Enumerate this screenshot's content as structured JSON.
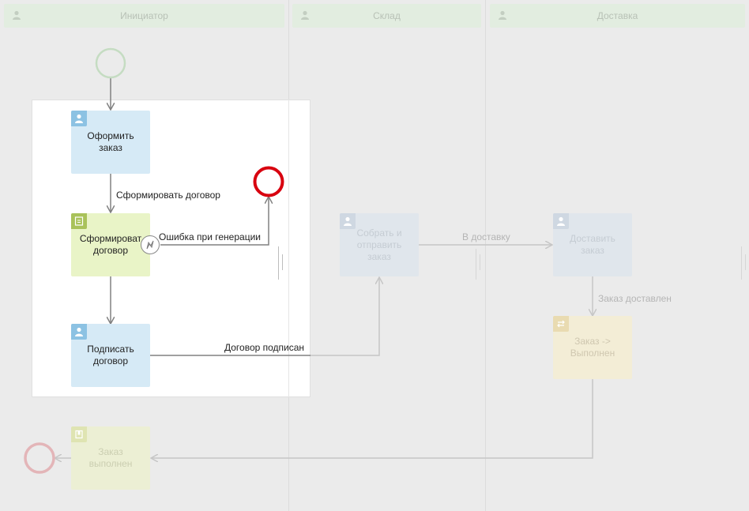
{
  "lanes": [
    {
      "name": "Инициатор"
    },
    {
      "name": "Склад"
    },
    {
      "name": "Доставка"
    }
  ],
  "tasks": {
    "form_order": "Оформить\nзаказ",
    "generate_contract": "Сформироват\nдоговор",
    "sign_contract": "Подписать\nдоговор",
    "collect_ship": "Собрать и\nотправить\nзаказ",
    "deliver_order": "Доставить\nзаказ",
    "order_to_done": "Заказ ->\nВыполнен",
    "order_done": "Заказ\nвыполнен"
  },
  "flows": {
    "make_contract": "Сформировать договор",
    "generation_error": "Ошибка при генерации",
    "contract_signed": "Договор подписан",
    "to_delivery": "В доставку",
    "order_delivered": "Заказ доставлен"
  },
  "colors": {
    "start_event": "#c5dcc2",
    "error_end_event": "#d8000f",
    "faded_end_event": "#e3b5b8"
  },
  "icons": {
    "lane": "user-icon",
    "user_task": "user-icon",
    "script_task": "document-icon",
    "change_status_task": "swap-icon",
    "end_task": "flag-icon",
    "boundary_error": "lightning-icon"
  }
}
